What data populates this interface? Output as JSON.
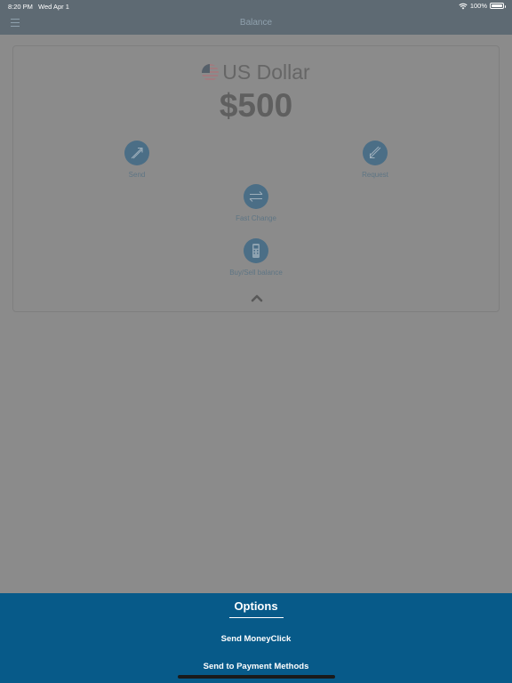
{
  "status_bar": {
    "time": "8:20 PM",
    "date": "Wed Apr 1",
    "battery": "100%"
  },
  "nav": {
    "title": "Balance",
    "menu_icon": "hamburger-icon"
  },
  "balance": {
    "currency": "US Dollar",
    "currency_icon": "us-flag-icon",
    "amount": "$500"
  },
  "actions": {
    "send": {
      "label": "Send",
      "icon": "send-arrow-icon"
    },
    "request": {
      "label": "Request",
      "icon": "request-arrow-icon"
    },
    "fast_change": {
      "label": "Fast Change",
      "icon": "exchange-arrows-icon"
    },
    "buy_sell": {
      "label": "Buy/Sell balance",
      "icon": "card-reader-icon"
    }
  },
  "collapse_icon": "chevron-up-icon",
  "options_sheet": {
    "title": "Options",
    "items": [
      "Send MoneyClick",
      "Send to Payment Methods"
    ]
  },
  "colors": {
    "accent": "#075a89",
    "icon_circle": "#4b6e86",
    "nav_bg": "#5e6a73",
    "overlay": "#8b8b8b"
  }
}
